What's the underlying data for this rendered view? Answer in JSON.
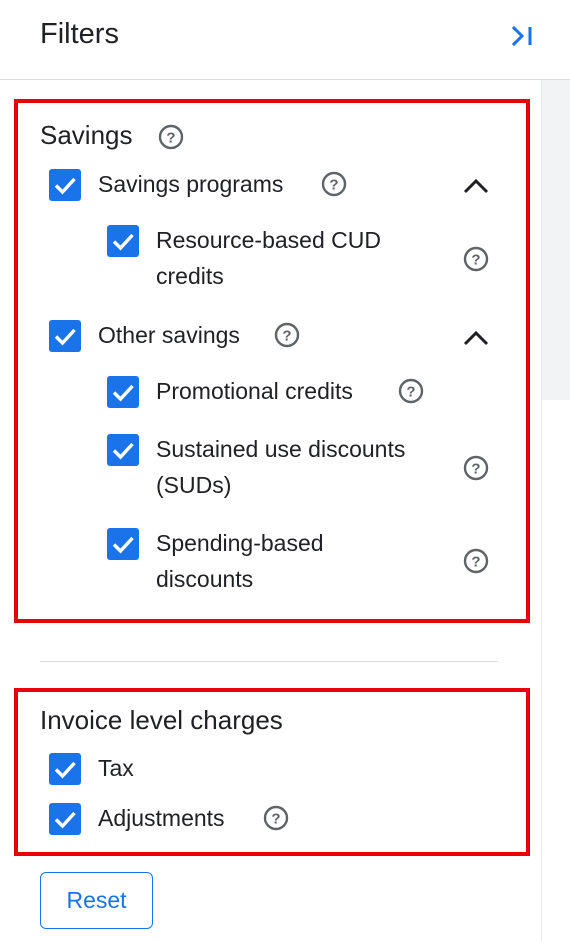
{
  "header": {
    "title": "Filters",
    "collapse_icon": "collapse-panel-icon"
  },
  "savings": {
    "title": "Savings",
    "groups": [
      {
        "label": "Savings programs",
        "checked": true,
        "expanded": true,
        "items": [
          {
            "label_lines": [
              "Resource-based CUD",
              "credits"
            ],
            "checked": true
          }
        ]
      },
      {
        "label": "Other savings",
        "checked": true,
        "expanded": true,
        "items": [
          {
            "label_lines": [
              "Promotional credits"
            ],
            "checked": true
          },
          {
            "label_lines": [
              "Sustained use discounts",
              "(SUDs)"
            ],
            "checked": true
          },
          {
            "label_lines": [
              "Spending-based",
              "discounts"
            ],
            "checked": true
          }
        ]
      }
    ]
  },
  "invoice": {
    "title": "Invoice level charges",
    "items": [
      {
        "label": "Tax",
        "checked": true
      },
      {
        "label": "Adjustments",
        "checked": true
      }
    ]
  },
  "reset_label": "Reset",
  "colors": {
    "accent": "#1a73e8",
    "highlight": "#e8000b",
    "text": "#202124",
    "icon": "#5f6368"
  }
}
